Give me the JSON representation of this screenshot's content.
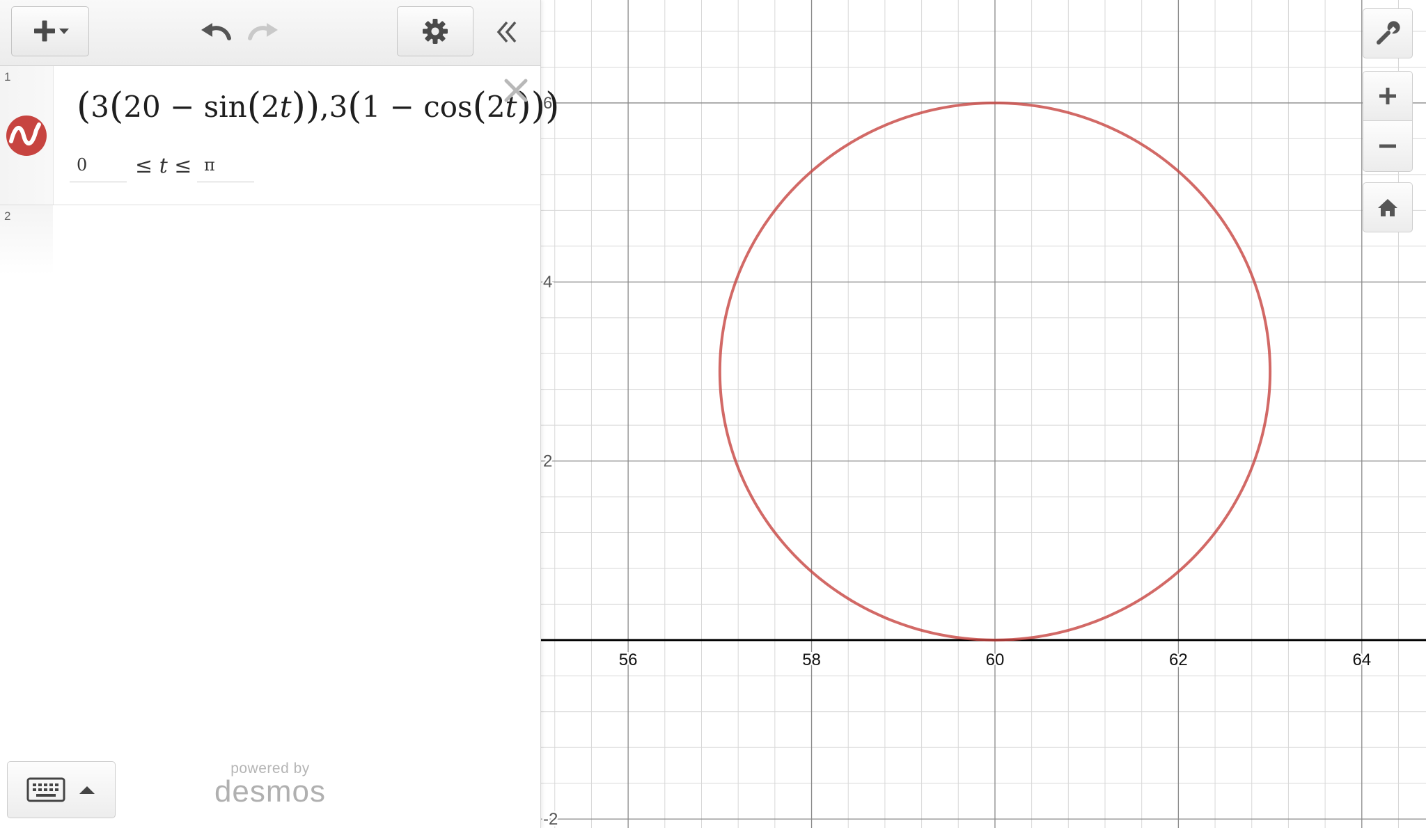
{
  "toolbar": {
    "add_icon": "plus-dropdown-icon",
    "undo_icon": "undo-icon",
    "redo_icon": "redo-icon",
    "settings_icon": "gear-icon",
    "collapse_icon": "double-chevron-left-icon"
  },
  "expressions": [
    {
      "number": "1",
      "icon": "parametric-curve-icon",
      "color": "#c74440",
      "latex_display": "(3(20 − sin(2t)),3(1 − cos(2t)))",
      "parts": {
        "p1": "3",
        "p2": "20 − sin",
        "p3": "2",
        "p4": "t",
        "p5": ",3",
        "p6": "1 − cos",
        "p7": "2",
        "p8": "t"
      },
      "domain_min": "0",
      "domain_op_left": "≤ ",
      "domain_var": "t",
      "domain_op_right": " ≤",
      "domain_max": "π"
    },
    {
      "number": "2"
    }
  ],
  "branding": {
    "powered_by": "powered by",
    "name": "desmos"
  },
  "keyboard": {
    "icon": "keyboard-icon",
    "toggle_icon": "caret-up-icon"
  },
  "graph_controls": {
    "wrench_icon": "wrench-icon",
    "zoom_in_icon": "plus-icon",
    "zoom_out_icon": "minus-icon",
    "home_icon": "home-icon"
  },
  "graph": {
    "x_min": 55.05,
    "x_max": 64.7,
    "y_min": -2.1,
    "y_max": 7.15,
    "major_step": 2,
    "minor_step": 0.4,
    "x_tick_labels": [
      "56",
      "58",
      "60",
      "62",
      "64"
    ],
    "y_tick_labels": [
      "6",
      "4",
      "2",
      "-2"
    ],
    "grid": true,
    "axis_color": "#000000",
    "major_grid_color": "#8a8a8a",
    "minor_grid_color": "#d8d8d8"
  },
  "chart_data": {
    "type": "line",
    "series": [
      {
        "color": "#c74440",
        "parametric": true,
        "x_expr": "3(20 - sin(2t))",
        "y_expr": "3(1 - cos(2t))",
        "t_range": [
          0,
          3.14159
        ],
        "center": [
          60,
          3
        ],
        "radius": 3
      }
    ],
    "xlim": [
      55.05,
      64.7
    ],
    "ylim": [
      -2.1,
      7.15
    ],
    "grid": true
  }
}
